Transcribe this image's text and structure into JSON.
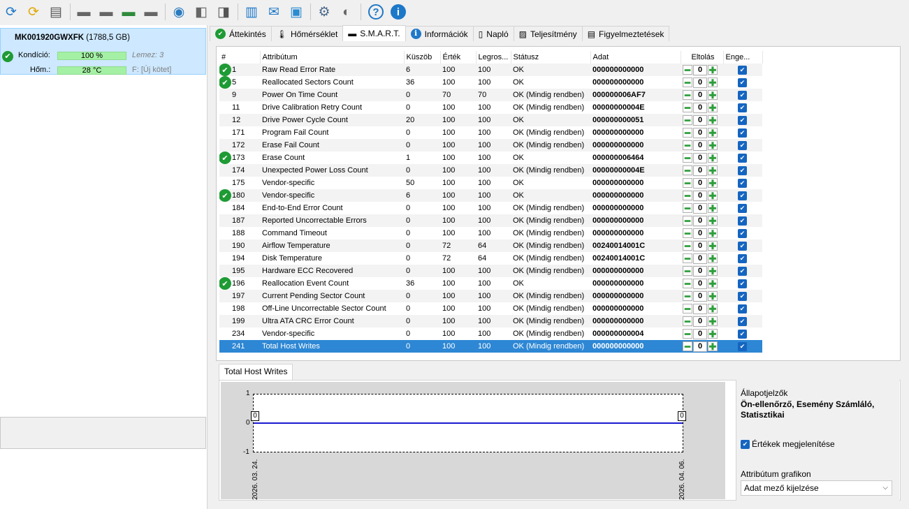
{
  "toolbar": {
    "icons": [
      "refresh-icon",
      "refresh-warning-icon",
      "disk-list-icon",
      "disk-icon",
      "disk-clock-icon",
      "disk-check-icon",
      "disk-search-icon",
      "globe-disk-icon",
      "disk-settings-icon",
      "disk-eject-icon",
      "notes-icon",
      "mail-icon",
      "monitor-icon",
      "gear-icon",
      "speaker-icon",
      "help-icon",
      "info-icon"
    ]
  },
  "disk": {
    "name": "MK001920GWXFK",
    "size": "(1788,5 GB)",
    "condition_label": "Kondíció:",
    "condition_value": "100 %",
    "condition_percent": 100,
    "disk_label": "Lemez: 3",
    "temp_label": "Hőm.:",
    "temp_value": "28 °C",
    "drive_letter": "F:",
    "volume": "[Új kötet]"
  },
  "tabs": [
    {
      "label": "Áttekintés",
      "icon": "check-icon"
    },
    {
      "label": "Hőmérséklet",
      "icon": "thermometer-icon"
    },
    {
      "label": "S.M.A.R.T.",
      "icon": "disk-icon"
    },
    {
      "label": "Információk",
      "icon": "info-icon"
    },
    {
      "label": "Napló",
      "icon": "log-icon"
    },
    {
      "label": "Teljesítmény",
      "icon": "performance-icon"
    },
    {
      "label": "Figyelmeztetések",
      "icon": "alerts-icon"
    }
  ],
  "columns": {
    "num": "#",
    "attr": "Attribútum",
    "threshold": "Küszöb",
    "value": "Érték",
    "worst": "Legros...",
    "status": "Státusz",
    "data": "Adat",
    "offset": "Eltolás",
    "enable": "Enge..."
  },
  "rows": [
    {
      "id": "1",
      "name": "Raw Read Error Rate",
      "th": "6",
      "val": "100",
      "worst": "100",
      "status": "OK",
      "data": "000000000000",
      "ok": true
    },
    {
      "id": "5",
      "name": "Reallocated Sectors Count",
      "th": "36",
      "val": "100",
      "worst": "100",
      "status": "OK",
      "data": "000000000000",
      "ok": true
    },
    {
      "id": "9",
      "name": "Power On Time Count",
      "th": "0",
      "val": "70",
      "worst": "70",
      "status": "OK (Mindig rendben)",
      "data": "000000006AF7",
      "ok": false
    },
    {
      "id": "11",
      "name": "Drive Calibration Retry Count",
      "th": "0",
      "val": "100",
      "worst": "100",
      "status": "OK (Mindig rendben)",
      "data": "00000000004E",
      "ok": false
    },
    {
      "id": "12",
      "name": "Drive Power Cycle Count",
      "th": "20",
      "val": "100",
      "worst": "100",
      "status": "OK",
      "data": "000000000051",
      "ok": false
    },
    {
      "id": "171",
      "name": "Program Fail Count",
      "th": "0",
      "val": "100",
      "worst": "100",
      "status": "OK (Mindig rendben)",
      "data": "000000000000",
      "ok": false
    },
    {
      "id": "172",
      "name": "Erase Fail Count",
      "th": "0",
      "val": "100",
      "worst": "100",
      "status": "OK (Mindig rendben)",
      "data": "000000000000",
      "ok": false
    },
    {
      "id": "173",
      "name": "Erase Count",
      "th": "1",
      "val": "100",
      "worst": "100",
      "status": "OK",
      "data": "000000006464",
      "ok": true
    },
    {
      "id": "174",
      "name": "Unexpected Power Loss Count",
      "th": "0",
      "val": "100",
      "worst": "100",
      "status": "OK (Mindig rendben)",
      "data": "00000000004E",
      "ok": false
    },
    {
      "id": "175",
      "name": "Vendor-specific",
      "th": "50",
      "val": "100",
      "worst": "100",
      "status": "OK",
      "data": "000000000000",
      "ok": false
    },
    {
      "id": "180",
      "name": "Vendor-specific",
      "th": "6",
      "val": "100",
      "worst": "100",
      "status": "OK",
      "data": "000000000000",
      "ok": true
    },
    {
      "id": "184",
      "name": "End-to-End Error Count",
      "th": "0",
      "val": "100",
      "worst": "100",
      "status": "OK (Mindig rendben)",
      "data": "000000000000",
      "ok": false
    },
    {
      "id": "187",
      "name": "Reported Uncorrectable Errors",
      "th": "0",
      "val": "100",
      "worst": "100",
      "status": "OK (Mindig rendben)",
      "data": "000000000000",
      "ok": false
    },
    {
      "id": "188",
      "name": "Command Timeout",
      "th": "0",
      "val": "100",
      "worst": "100",
      "status": "OK (Mindig rendben)",
      "data": "000000000000",
      "ok": false
    },
    {
      "id": "190",
      "name": "Airflow Temperature",
      "th": "0",
      "val": "72",
      "worst": "64",
      "status": "OK (Mindig rendben)",
      "data": "00240014001C",
      "ok": false
    },
    {
      "id": "194",
      "name": "Disk Temperature",
      "th": "0",
      "val": "72",
      "worst": "64",
      "status": "OK (Mindig rendben)",
      "data": "00240014001C",
      "ok": false
    },
    {
      "id": "195",
      "name": "Hardware ECC Recovered",
      "th": "0",
      "val": "100",
      "worst": "100",
      "status": "OK (Mindig rendben)",
      "data": "000000000000",
      "ok": false
    },
    {
      "id": "196",
      "name": "Reallocation Event Count",
      "th": "36",
      "val": "100",
      "worst": "100",
      "status": "OK",
      "data": "000000000000",
      "ok": true
    },
    {
      "id": "197",
      "name": "Current Pending Sector Count",
      "th": "0",
      "val": "100",
      "worst": "100",
      "status": "OK (Mindig rendben)",
      "data": "000000000000",
      "ok": false
    },
    {
      "id": "198",
      "name": "Off-Line Uncorrectable Sector Count",
      "th": "0",
      "val": "100",
      "worst": "100",
      "status": "OK (Mindig rendben)",
      "data": "000000000000",
      "ok": false
    },
    {
      "id": "199",
      "name": "Ultra ATA CRC Error Count",
      "th": "0",
      "val": "100",
      "worst": "100",
      "status": "OK (Mindig rendben)",
      "data": "000000000000",
      "ok": false
    },
    {
      "id": "234",
      "name": "Vendor-specific",
      "th": "0",
      "val": "100",
      "worst": "100",
      "status": "OK (Mindig rendben)",
      "data": "000000000004",
      "ok": false
    },
    {
      "id": "241",
      "name": "Total Host Writes",
      "th": "0",
      "val": "100",
      "worst": "100",
      "status": "OK (Mindig rendben)",
      "data": "000000000000",
      "ok": false,
      "selected": true
    }
  ],
  "offset_value": "0",
  "graph": {
    "tab_label": "Total Host Writes",
    "y_ticks": [
      "1",
      "0",
      "-1"
    ],
    "x_start": "2026. 03. 24.",
    "x_end": "2026. 04. 06.",
    "start_value": "0",
    "end_value": "0",
    "series_color": "#1a1ad0"
  },
  "options": {
    "flags_title": "Állapotjelzők",
    "flags_value": "Ön-ellenőrző, Esemény Számláló, Statisztikai",
    "show_values_label": "Értékek megjelenítése",
    "show_values_checked": true,
    "attr_graph_label": "Attribútum grafikon",
    "attr_graph_select": "Adat mező kijelzése"
  }
}
